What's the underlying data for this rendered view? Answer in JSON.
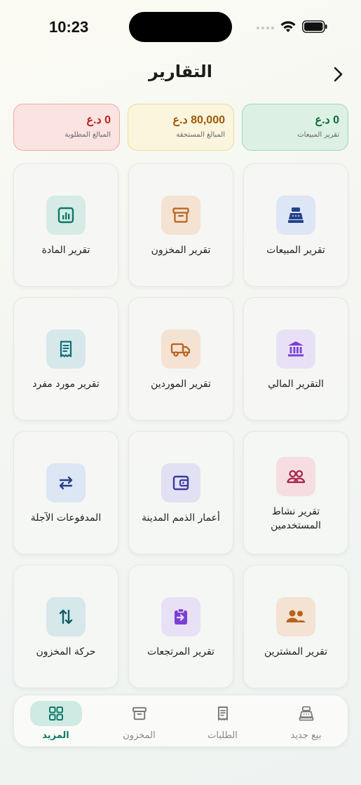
{
  "status_bar": {
    "time": "10:23"
  },
  "header": {
    "title": "التقارير",
    "back_icon": "chevron-right-icon"
  },
  "summary": [
    {
      "value": "0 د.ع",
      "label": "المبالغ المطلوبة",
      "bg": "#fbe3e1",
      "border": "#f0a9a4",
      "color": "#b3261e"
    },
    {
      "value": "80,000 د.ع",
      "label": "المبالغ المستحقة",
      "bg": "#faf5dc",
      "border": "#eadd9a",
      "color": "#a0580a"
    },
    {
      "value": "0 د.ع",
      "label": "تقرير المبيعات",
      "bg": "#dcf1e4",
      "border": "#9fd6b5",
      "color": "#0f6b34"
    }
  ],
  "tiles": [
    {
      "label": "تقرير المادة",
      "icon": "chart-report-icon",
      "bg": "#d6ebe6",
      "color": "#0f7a68"
    },
    {
      "label": "تقرير المخزون",
      "icon": "archive-box-icon",
      "bg": "#f4e2d3",
      "color": "#b8621c"
    },
    {
      "label": "تقرير المبيعات",
      "icon": "cash-register-icon",
      "bg": "#dde6f5",
      "color": "#24428a"
    },
    {
      "label": "تقرير مورد مفرد",
      "icon": "receipt-icon",
      "bg": "#d6e8ea",
      "color": "#0f6d7a"
    },
    {
      "label": "تقرير الموردين",
      "icon": "truck-icon",
      "bg": "#f4e2d3",
      "color": "#b8621c"
    },
    {
      "label": "التقرير المالي",
      "icon": "bank-icon",
      "bg": "#e8e1f6",
      "color": "#7b3fd4"
    },
    {
      "label": "المدفوعات الآجلة",
      "icon": "swap-arrows-icon",
      "bg": "#dde6f5",
      "color": "#24428a"
    },
    {
      "label": "أعمار الذمم المدينة",
      "icon": "wallet-icon",
      "bg": "#e1e1f3",
      "color": "#3b3aa0"
    },
    {
      "label": "تقرير نشاط المستخدمين",
      "icon": "users-group-icon",
      "bg": "#f5dde2",
      "color": "#a8244b"
    },
    {
      "label": "حركة المخزون",
      "icon": "up-down-arrows-icon",
      "bg": "#d6e8ea",
      "color": "#0f5e68"
    },
    {
      "label": "تقرير المرتجعات",
      "icon": "clipboard-return-icon",
      "bg": "#e8e1f6",
      "color": "#7b3fd4"
    },
    {
      "label": "تقرير المشترين",
      "icon": "customers-icon",
      "bg": "#f4e2d3",
      "color": "#b8621c"
    }
  ],
  "nav": [
    {
      "label": "المزيد",
      "icon": "grid-icon",
      "active": true
    },
    {
      "label": "المخزون",
      "icon": "archive-box-icon",
      "active": false
    },
    {
      "label": "الطلبات",
      "icon": "receipt-icon",
      "active": false
    },
    {
      "label": "بيع جديد",
      "icon": "cash-register-icon",
      "active": false
    }
  ]
}
